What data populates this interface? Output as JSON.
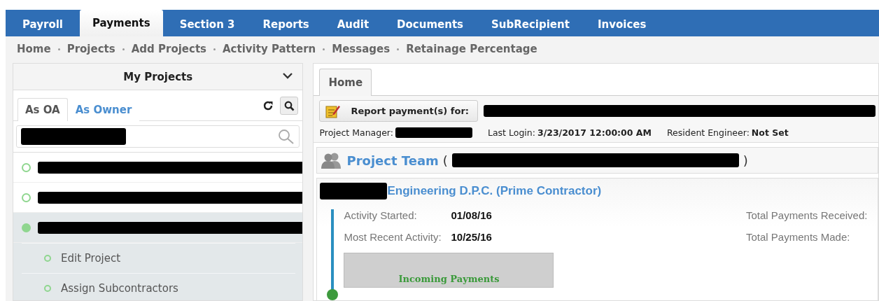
{
  "main_tabs": [
    {
      "label": "Payroll",
      "selected": false
    },
    {
      "label": "Payments",
      "selected": true
    },
    {
      "label": "Section 3",
      "selected": false
    },
    {
      "label": "Reports",
      "selected": false
    },
    {
      "label": "Audit",
      "selected": false
    },
    {
      "label": "Documents",
      "selected": false
    },
    {
      "label": "SubRecipient",
      "selected": false
    },
    {
      "label": "Invoices",
      "selected": false
    }
  ],
  "sub_nav": [
    "Home",
    "Projects",
    "Add Projects",
    "Activity Pattern",
    "Messages",
    "Retainage Percentage"
  ],
  "sidebar": {
    "title": "My Projects",
    "tabs": [
      {
        "label": "As OA",
        "selected": true
      },
      {
        "label": "As Owner",
        "selected": false
      }
    ],
    "projects": [
      {
        "selected": false
      },
      {
        "selected": false
      },
      {
        "selected": true,
        "children": [
          {
            "label": "Edit Project"
          },
          {
            "label": "Assign Subcontractors"
          }
        ]
      }
    ]
  },
  "content": {
    "tabs": [
      {
        "label": "Home",
        "selected": true
      }
    ],
    "report_button": "Report payment(s) for:",
    "info": [
      {
        "label": "Project Manager:"
      },
      {
        "label": "Last Login:",
        "value": "3/23/2017 12:00:00 AM"
      },
      {
        "label": "Resident Engineer:",
        "value": "Not Set"
      }
    ],
    "team_title": "Project Team",
    "team_brackets": [
      "(",
      ")"
    ],
    "contractor": "Engineering D.P.C. (Prime Contractor)",
    "activity": [
      {
        "label": "Activity Started:",
        "value": "01/08/16"
      },
      {
        "label": "Most Recent Activity:",
        "value": "10/25/16"
      }
    ],
    "totals": [
      "Total Payments Received:",
      "Total Payments Made:"
    ],
    "incoming": "Incoming Payments"
  }
}
